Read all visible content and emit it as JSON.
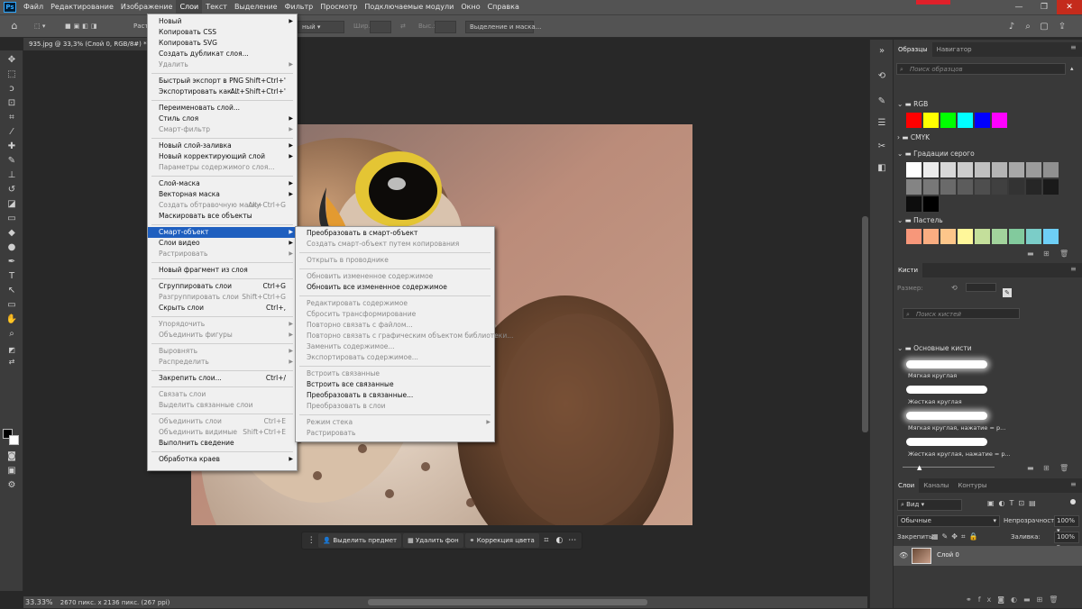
{
  "menubar": {
    "logo": "Ps",
    "items": [
      "Файл",
      "Редактирование",
      "Изображение",
      "Слои",
      "Текст",
      "Выделение",
      "Фильтр",
      "Просмотр",
      "Подключаемые модули",
      "Окно",
      "Справка"
    ]
  },
  "window_controls": {
    "minimize": "—",
    "maximize": "❐",
    "close": "✕"
  },
  "options": {
    "mode_partial": "Раст",
    "style_partial": "ный",
    "width_label": "Шир.:",
    "height_label": "Выс.:",
    "select_mask": "Выделение и маска..."
  },
  "document": {
    "tab": "935.jpg @ 33,3% (Слой 0, RGB/8#) *",
    "zoom": "33.33%",
    "info": "2670 пикс. x 2136 пикс. (267 ppi)"
  },
  "context_bar": {
    "select_subject": "Выделить предмет",
    "remove_bg": "Удалить фон",
    "color_correction": "Коррекция цвета"
  },
  "layer_menu": [
    {
      "label": "Новый",
      "arrow": true
    },
    {
      "label": "Копировать CSS"
    },
    {
      "label": "Копировать SVG"
    },
    {
      "label": "Создать дубликат слоя..."
    },
    {
      "label": "Удалить",
      "arrow": true,
      "disabled": true
    },
    {
      "sep": true
    },
    {
      "label": "Быстрый экспорт в PNG",
      "shortcut": "Shift+Ctrl+'"
    },
    {
      "label": "Экспортировать как...",
      "shortcut": "Alt+Shift+Ctrl+'"
    },
    {
      "sep": true
    },
    {
      "label": "Переименовать слой..."
    },
    {
      "label": "Стиль слоя",
      "arrow": true
    },
    {
      "label": "Смарт-фильтр",
      "arrow": true,
      "disabled": true
    },
    {
      "sep": true
    },
    {
      "label": "Новый слой-заливка",
      "arrow": true
    },
    {
      "label": "Новый корректирующий слой",
      "arrow": true
    },
    {
      "label": "Параметры содержимого слоя...",
      "disabled": true
    },
    {
      "sep": true
    },
    {
      "label": "Слой-маска",
      "arrow": true
    },
    {
      "label": "Векторная маска",
      "arrow": true
    },
    {
      "label": "Создать обтравочную маску",
      "shortcut": "Alt+Ctrl+G",
      "disabled": true
    },
    {
      "label": "Маскировать все объекты"
    },
    {
      "sep": true
    },
    {
      "label": "Смарт-объект",
      "arrow": true,
      "selected": true
    },
    {
      "label": "Слои видео",
      "arrow": true
    },
    {
      "label": "Растрировать",
      "arrow": true,
      "disabled": true
    },
    {
      "sep": true
    },
    {
      "label": "Новый фрагмент из слоя"
    },
    {
      "sep": true
    },
    {
      "label": "Сгруппировать слои",
      "shortcut": "Ctrl+G"
    },
    {
      "label": "Разгруппировать слои",
      "shortcut": "Shift+Ctrl+G",
      "disabled": true
    },
    {
      "label": "Скрыть слои",
      "shortcut": "Ctrl+,"
    },
    {
      "sep": true
    },
    {
      "label": "Упорядочить",
      "arrow": true,
      "disabled": true
    },
    {
      "label": "Объединить фигуры",
      "arrow": true,
      "disabled": true
    },
    {
      "sep": true
    },
    {
      "label": "Выровнять",
      "arrow": true,
      "disabled": true
    },
    {
      "label": "Распределить",
      "arrow": true,
      "disabled": true
    },
    {
      "sep": true
    },
    {
      "label": "Закрепить слои...",
      "shortcut": "Ctrl+/"
    },
    {
      "sep": true
    },
    {
      "label": "Связать слои",
      "disabled": true
    },
    {
      "label": "Выделить связанные слои",
      "disabled": true
    },
    {
      "sep": true
    },
    {
      "label": "Объединить слои",
      "shortcut": "Ctrl+E",
      "disabled": true
    },
    {
      "label": "Объединить видимые",
      "shortcut": "Shift+Ctrl+E",
      "disabled": true
    },
    {
      "label": "Выполнить сведение"
    },
    {
      "sep": true
    },
    {
      "label": "Обработка краев",
      "arrow": true
    }
  ],
  "smart_menu": [
    {
      "label": "Преобразовать в смарт-объект"
    },
    {
      "label": "Создать смарт-объект путем копирования",
      "disabled": true
    },
    {
      "sep": true
    },
    {
      "label": "Открыть в проводнике",
      "disabled": true
    },
    {
      "sep": true
    },
    {
      "label": "Обновить измененное содержимое",
      "disabled": true
    },
    {
      "label": "Обновить все измененное содержимое"
    },
    {
      "sep": true
    },
    {
      "label": "Редактировать содержимое",
      "disabled": true
    },
    {
      "label": "Сбросить трансформирование",
      "disabled": true
    },
    {
      "label": "Повторно связать с файлом...",
      "disabled": true
    },
    {
      "label": "Повторно связать с графическим объектом библиотеки...",
      "disabled": true
    },
    {
      "label": "Заменить содержимое...",
      "disabled": true
    },
    {
      "label": "Экспортировать содержимое...",
      "disabled": true
    },
    {
      "sep": true
    },
    {
      "label": "Встроить связанные",
      "disabled": true
    },
    {
      "label": "Встроить все связанные"
    },
    {
      "label": "Преобразовать в связанные..."
    },
    {
      "label": "Преобразовать в слои",
      "disabled": true
    },
    {
      "sep": true
    },
    {
      "label": "Режим стека",
      "arrow": true,
      "disabled": true
    },
    {
      "label": "Растрировать",
      "disabled": true
    }
  ],
  "swatches": {
    "tabs": [
      "Образцы",
      "Навигатор"
    ],
    "search_placeholder": "Поиск образцов",
    "groups": [
      "RGB",
      "CMYK",
      "Градации серого",
      "Пастель"
    ],
    "rgb": [
      "#ff0000",
      "#ffff00",
      "#00ff00",
      "#00ffff",
      "#0000ff",
      "#ff00ff"
    ],
    "gray": [
      "#ffffff",
      "#ececec",
      "#d8d8d8",
      "#cccccc",
      "#c0c0c0",
      "#b4b4b4",
      "#a8a8a8",
      "#9c9c9c",
      "#909090",
      "#848484",
      "#787878",
      "#6a6a6a",
      "#5c5c5c",
      "#4e4e4e",
      "#404040",
      "#333333",
      "#262626",
      "#1a1a1a",
      "#0d0d0d",
      "#000000"
    ],
    "pastel": [
      "#f7977a",
      "#f9ad81",
      "#fdc68a",
      "#fff79a",
      "#c4df9b",
      "#a2d39c",
      "#82ca9d",
      "#7bcdc8",
      "#6ecff6"
    ]
  },
  "brushes": {
    "tab": "Кисти",
    "size_label": "Размер:",
    "search_placeholder": "Поиск кистей",
    "group": "Основные кисти",
    "items": [
      "Мягкая круглая",
      "Жесткая круглая",
      "Мягкая круглая, нажатие = р...",
      "Жесткая круглая, нажатие = р..."
    ]
  },
  "layers": {
    "tabs": [
      "Слои",
      "Каналы",
      "Контуры"
    ],
    "kind": "Вид",
    "blend": "Обычные",
    "opacity_label": "Непрозрачность:",
    "opacity": "100%",
    "lock_label": "Закрепить:",
    "fill_label": "Заливка:",
    "fill": "100%",
    "layer_name": "Слой 0"
  }
}
